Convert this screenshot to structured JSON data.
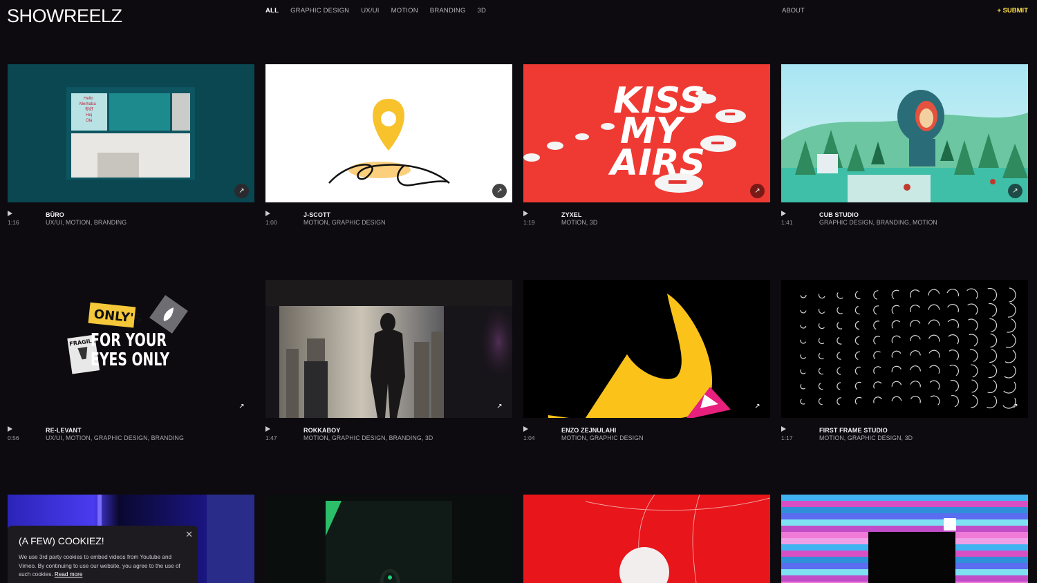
{
  "header": {
    "logo": "SHOWREELZ",
    "nav": [
      "ALL",
      "GRAPHIC DESIGN",
      "UX/UI",
      "MOTION",
      "BRANDING",
      "3D"
    ],
    "active_nav": "ALL",
    "about": "ABOUT",
    "submit": "+ SUBMIT"
  },
  "reels": [
    {
      "title": "BŪRO",
      "duration": "1:16",
      "tags": "UX/UI, MOTION, BRANDING",
      "art": "buro"
    },
    {
      "title": "J-SCOTT",
      "duration": "1:00",
      "tags": "MOTION, GRAPHIC DESIGN",
      "art": "jscott"
    },
    {
      "title": "ZYXEL",
      "duration": "1:19",
      "tags": "MOTION, 3D",
      "art": "zyxel"
    },
    {
      "title": "CUB STUDIO",
      "duration": "1:41",
      "tags": "GRAPHIC DESIGN, BRANDING, MOTION",
      "art": "cub"
    },
    {
      "title": "RE-LEVANT",
      "duration": "0:56",
      "tags": "UX/UI, MOTION, GRAPHIC DESIGN, BRANDING",
      "art": "relevant"
    },
    {
      "title": "ROKKABOY",
      "duration": "1:47",
      "tags": "MOTION, GRAPHIC DESIGN, BRANDING, 3D",
      "art": "rokkaboy"
    },
    {
      "title": "ENZO ZEJNULAHI",
      "duration": "1:04",
      "tags": "MOTION, GRAPHIC DESIGN",
      "art": "enzo"
    },
    {
      "title": "FIRST FRAME STUDIO",
      "duration": "1:17",
      "tags": "MOTION, GRAPHIC DESIGN, 3D",
      "art": "firstframe"
    }
  ],
  "thumb_text": {
    "buro_hello": "Hello",
    "buro_merhaba": "Merhaba",
    "buro_ni_hao": "你好",
    "buro_hej": "Hej",
    "buro_ola": "Olá",
    "kiss": "KISS",
    "my": "MY",
    "airs": "AIRS",
    "onlys": "ONLY'S",
    "fragile": "FRAGILE",
    "for_your": "FOR YOUR",
    "eyes_only": "EYES ONLY"
  },
  "cookie": {
    "title": "(A FEW) COOKIEZ!",
    "text": "We use 3rd party cookies to embed videos from Youtube and Vimeo. By continuing to use our website, you agree to the use of such cookies.",
    "link": "Read more"
  },
  "icons": {
    "arrow": "arrow-up-right-icon",
    "play": "play-icon",
    "close": "close-icon"
  }
}
